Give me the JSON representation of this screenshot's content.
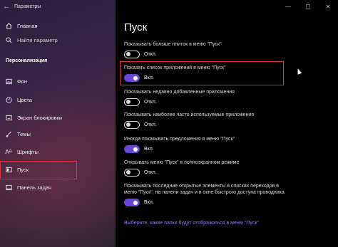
{
  "window": {
    "title": "Параметры",
    "minimize": "—",
    "maximize": "☐",
    "close": "✕"
  },
  "sidebar": {
    "home": "Главная",
    "search_placeholder": "Найти параметр",
    "section": "Персонализация",
    "items": [
      {
        "label": "Фон",
        "icon": "image-icon"
      },
      {
        "label": "Цвета",
        "icon": "palette-icon"
      },
      {
        "label": "Экран блокировки",
        "icon": "lock-screen-icon"
      },
      {
        "label": "Темы",
        "icon": "brush-icon"
      },
      {
        "label": "Шрифты",
        "icon": "font-icon"
      },
      {
        "label": "Пуск",
        "icon": "start-icon"
      },
      {
        "label": "Панель задач",
        "icon": "taskbar-icon"
      }
    ]
  },
  "main": {
    "title": "Пуск",
    "settings": [
      {
        "desc": "Показывать больше плиток в меню \"Пуск\"",
        "state": "Откл."
      },
      {
        "desc": "Показать список приложений в меню \"Пуск\"",
        "state": "Вкл."
      },
      {
        "desc": "Показывать недавно добавленные приложения",
        "state": "Откл."
      },
      {
        "desc": "Показывать наиболее часто используемые приложения",
        "state": "Откл."
      },
      {
        "desc": "Иногда показывать предложения в меню \"Пуск\"",
        "state": "Вкл."
      },
      {
        "desc": "Открывать меню \"Пуск\" в полноэкранном режиме",
        "state": "Откл."
      },
      {
        "desc": "Показывать последние открытые элементы в списках переходов в меню \"Пуск\", на панели задач и в окне быстрого доступа проводника",
        "state": "Вкл."
      }
    ],
    "link": "Выберите, какие папки будут отображаться в меню \"Пуск\""
  },
  "colors": {
    "accent": "#6b46d6",
    "highlight": "#e0333d",
    "link": "#8a7bf0"
  }
}
